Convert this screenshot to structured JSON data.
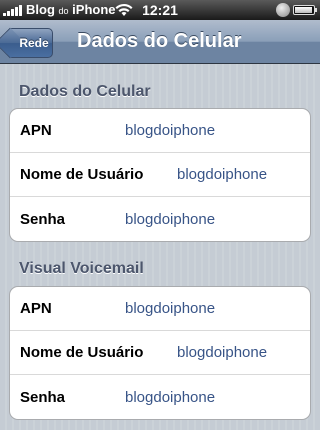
{
  "status_bar": {
    "carrier": "Blog",
    "carrier_small": "do",
    "carrier_suffix": "iPhone",
    "time": "12:21"
  },
  "nav": {
    "back_label": "Rede",
    "title": "Dados do Celular"
  },
  "sections": [
    {
      "header": "Dados do Celular",
      "rows": [
        {
          "label": "APN",
          "value": "blogdoiphone"
        },
        {
          "label": "Nome de Usuário",
          "value": "blogdoiphone"
        },
        {
          "label": "Senha",
          "value": "blogdoiphone"
        }
      ]
    },
    {
      "header": "Visual Voicemail",
      "rows": [
        {
          "label": "APN",
          "value": "blogdoiphone"
        },
        {
          "label": "Nome de Usuário",
          "value": "blogdoiphone"
        },
        {
          "label": "Senha",
          "value": "blogdoiphone"
        }
      ]
    }
  ]
}
